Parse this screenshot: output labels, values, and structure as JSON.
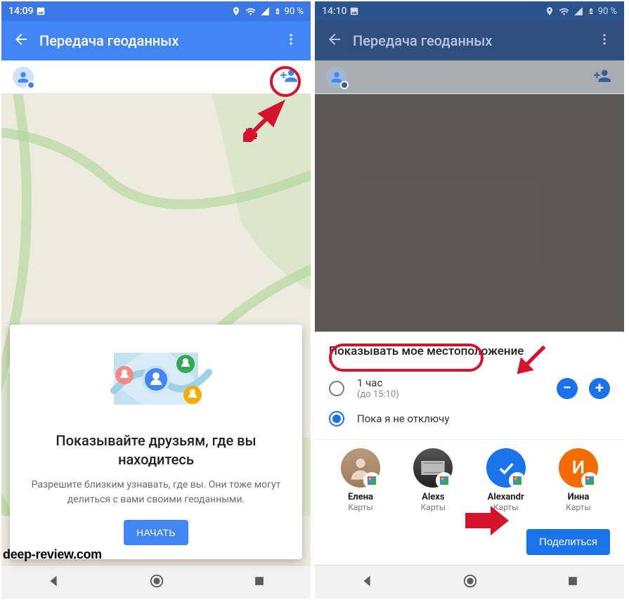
{
  "watermark": "deep-review.com",
  "screen1": {
    "status": {
      "time": "14:09",
      "battery": "90 %"
    },
    "title": "Передача геоданных",
    "card": {
      "heading": "Показывайте друзьям, где вы находитесь",
      "body": "Разрешите близким узнавать, где вы. Они тоже могут делиться с вами своими геоданными.",
      "button": "НАЧАТЬ"
    }
  },
  "screen2": {
    "status": {
      "time": "14:10",
      "battery": "90 %"
    },
    "title": "Передача геоданных",
    "sheet": {
      "heading": "Показывать мое местоположение",
      "opt1": {
        "label": "1 час",
        "sub": "(до 15:10)"
      },
      "opt2": {
        "label": "Пока я не отключу"
      },
      "contacts": [
        {
          "name": "Елена",
          "source": "Карты"
        },
        {
          "name": "Alexs",
          "source": "Карты"
        },
        {
          "name": "Alexandr",
          "source": "Карты"
        },
        {
          "name": "Инна",
          "source": "Карты"
        }
      ],
      "share": "Поделиться",
      "initial_inna": "И"
    }
  }
}
